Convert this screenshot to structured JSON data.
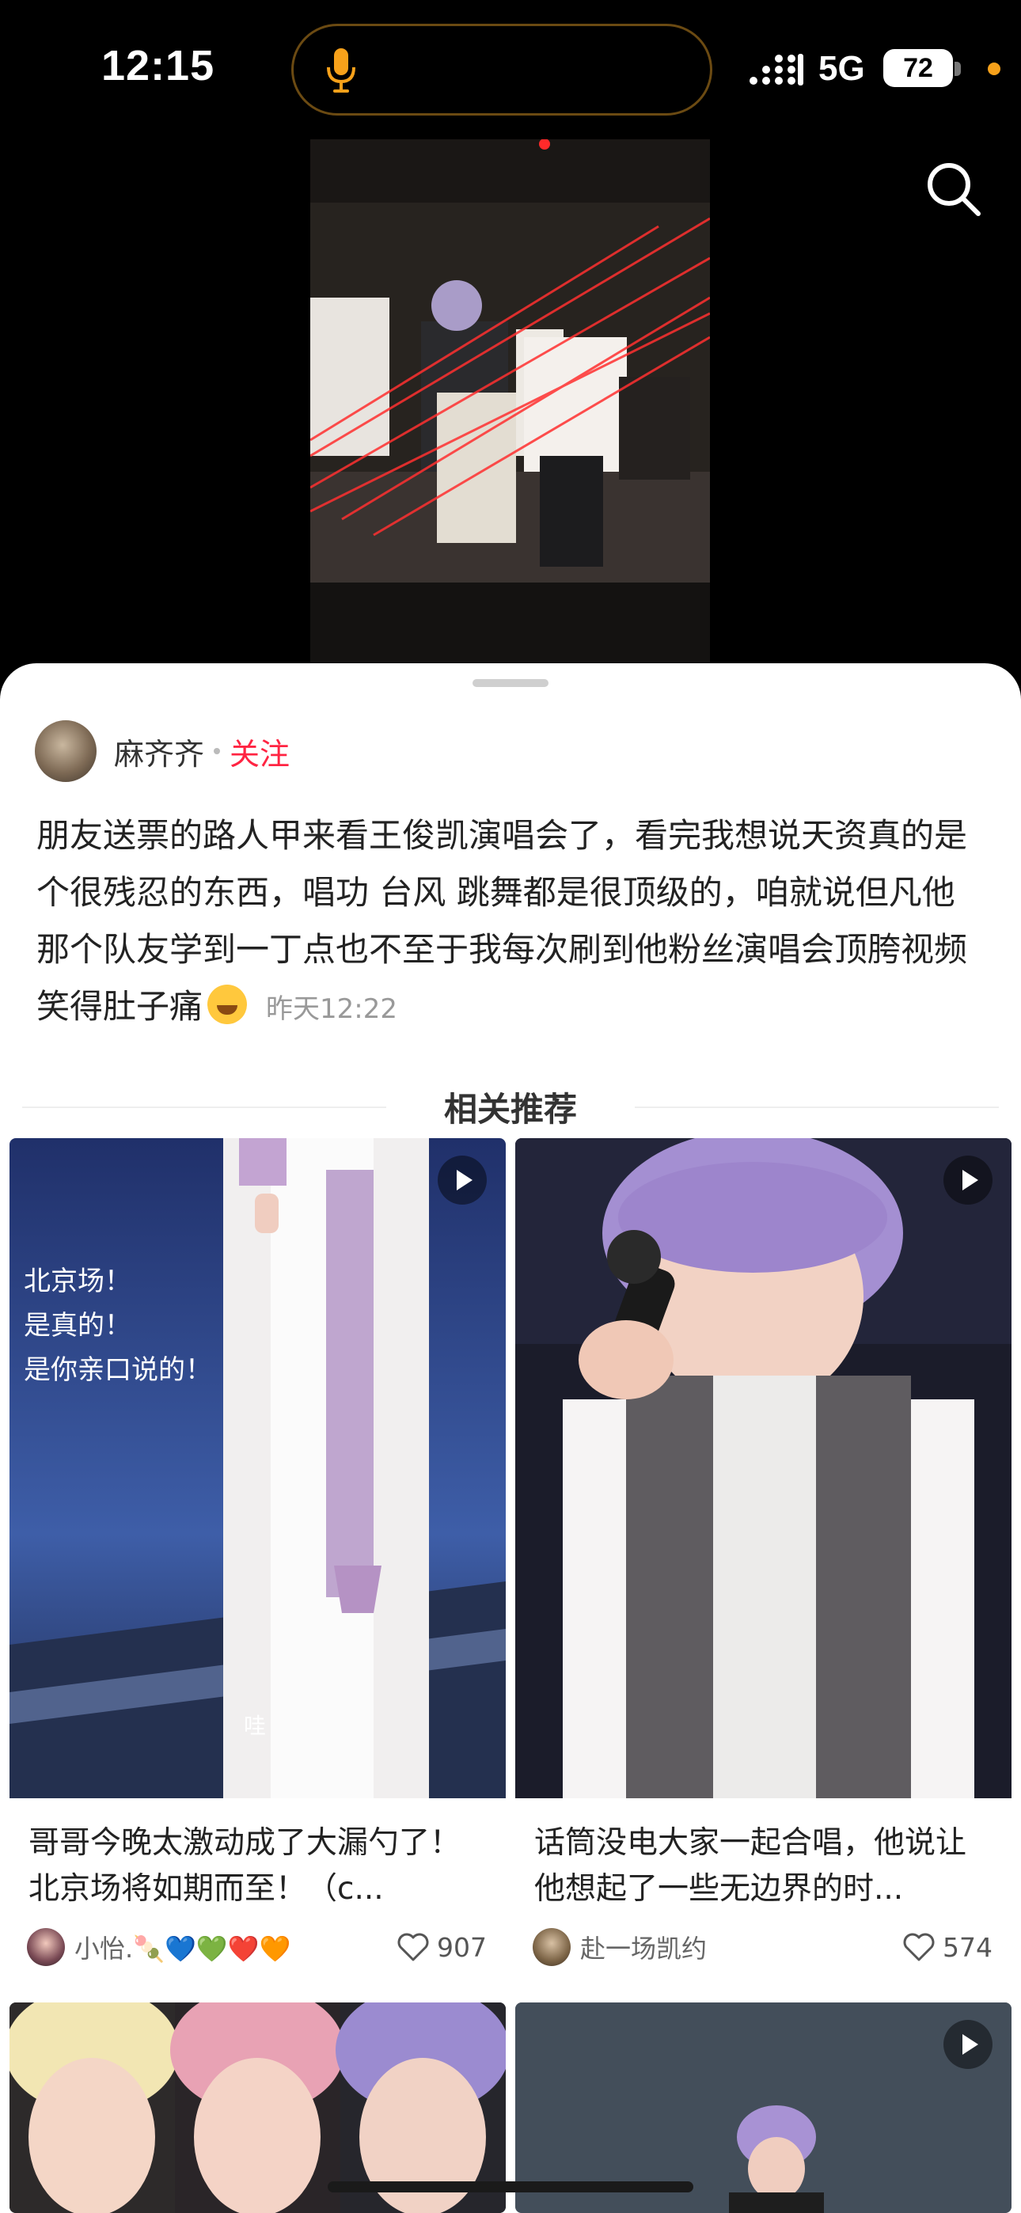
{
  "status_bar": {
    "time": "12:15",
    "network": "5G",
    "battery": "72",
    "accent": "#f7a11a"
  },
  "post": {
    "author": "麻齐齐",
    "follow_label": "关注",
    "text": "朋友送票的路人甲来看王俊凯演唱会了，看完我想说天资真的是个很残忍的东西，唱功 台风 跳舞都是很顶级的，咱就说但凡他那个队友学到一丁点也不至于我每次刷到他粉丝演唱会顶胯视频笑得肚子痛",
    "emoji": "grinning-face",
    "time": "昨天12:22"
  },
  "section_title": "相关推荐",
  "cards": [
    {
      "title": "哥哥今晚太激动成了大漏勺了！北京场将如期而至！（c...",
      "author": "小怡.🍡💙💚❤️🧡",
      "likes": "907",
      "overlay_lines": [
        "北京场！",
        "是真的！",
        "是你亲口说的！"
      ],
      "caption": "哇"
    },
    {
      "title": "话筒没电大家一起合唱，他说让他想起了一些无边界的时...",
      "author": "赴一场凯约",
      "likes": "574"
    }
  ],
  "icons": {
    "mic": "mic-icon",
    "search": "search-icon",
    "like": "heart-outline-icon",
    "play": "play-icon"
  }
}
